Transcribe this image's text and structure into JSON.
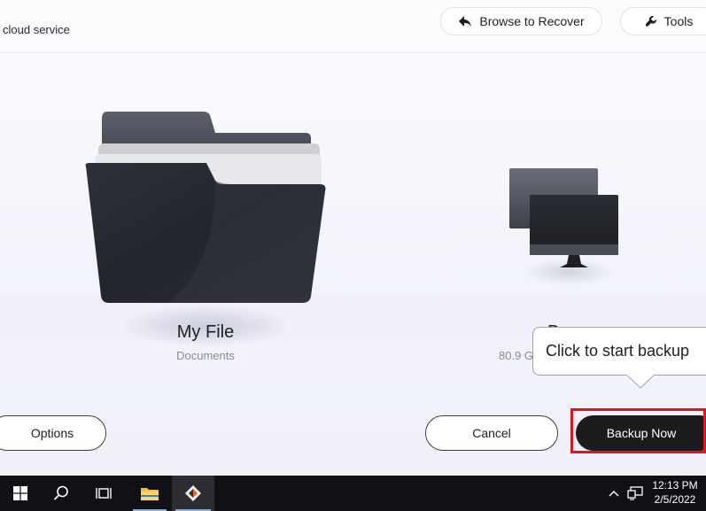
{
  "app": {
    "title": "cloud service",
    "header_buttons": {
      "browse_to_recover": "Browse to Recover",
      "tools": "Tools"
    }
  },
  "source": {
    "name": "My File",
    "subtitle": "Documents",
    "icon": "folder-icon"
  },
  "destination": {
    "name_partial": "D",
    "capacity_partial": "80.9 G",
    "icon": "computer-icon"
  },
  "tooltip": {
    "text": "Click to start backup"
  },
  "footer": {
    "options_label": "Options",
    "cancel_label": "Cancel",
    "backup_label": "Backup Now"
  },
  "taskbar": {
    "time": "12:13 PM",
    "date": "2/5/2022",
    "items": [
      "windows-start-icon",
      "search-icon",
      "task-view-icon",
      "file-explorer-icon",
      "backup-app-icon"
    ]
  },
  "colors": {
    "primary_button": "#1c1c1f",
    "highlight_border": "#e4141b",
    "taskbar": "#101114"
  }
}
